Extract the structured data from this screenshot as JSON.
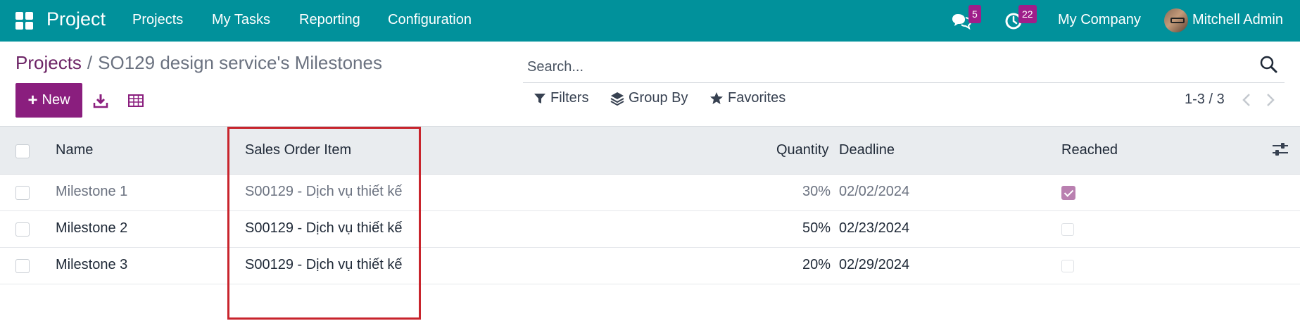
{
  "navbar": {
    "app_name": "Project",
    "menu": [
      "Projects",
      "My Tasks",
      "Reporting",
      "Configuration"
    ],
    "messages_count": "5",
    "activities_count": "22",
    "company": "My Company",
    "user": "Mitchell Admin",
    "color": "#01919b"
  },
  "breadcrumb": {
    "parent": "Projects",
    "separator": "/",
    "current": "SO129 design service's Milestones"
  },
  "toolbar": {
    "new_label": "New"
  },
  "search": {
    "placeholder": "Search..."
  },
  "filters": {
    "filters_label": "Filters",
    "group_by_label": "Group By",
    "favorites_label": "Favorites"
  },
  "pager": {
    "text": "1-3 / 3"
  },
  "table": {
    "columns": {
      "name": "Name",
      "sales_order_item": "Sales Order Item",
      "quantity": "Quantity",
      "deadline": "Deadline",
      "reached": "Reached"
    },
    "rows": [
      {
        "name": "Milestone 1",
        "sales_order_item": "S00129 - Dịch vụ thiết kế",
        "quantity": "30%",
        "deadline": "02/02/2024",
        "reached": true
      },
      {
        "name": "Milestone 2",
        "sales_order_item": "S00129 - Dịch vụ thiết kế",
        "quantity": "50%",
        "deadline": "02/23/2024",
        "reached": false
      },
      {
        "name": "Milestone 3",
        "sales_order_item": "S00129 - Dịch vụ thiết kế",
        "quantity": "20%",
        "deadline": "02/29/2024",
        "reached": false
      }
    ]
  },
  "colors": {
    "primary": "#8a1e7e",
    "badge": "#9f1e8a",
    "highlight": "#c8242c"
  }
}
